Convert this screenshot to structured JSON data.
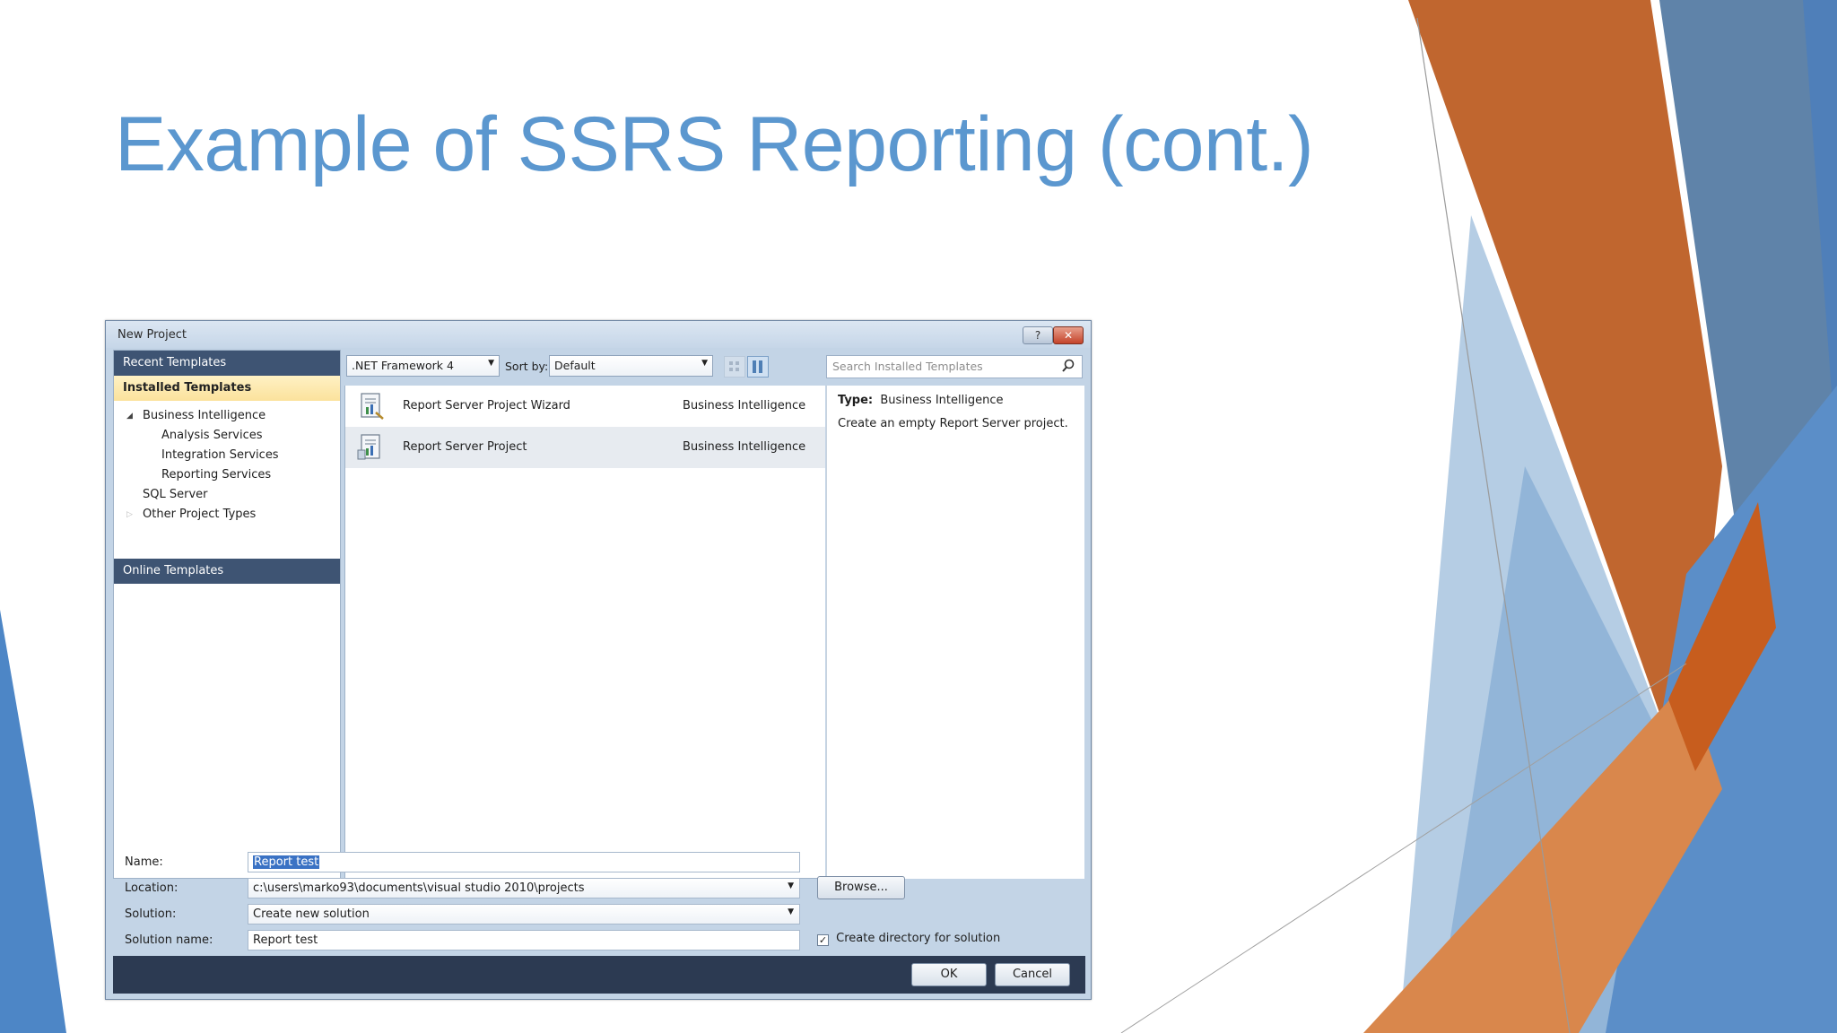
{
  "slide": {
    "title": "Example of SSRS Reporting (cont.)",
    "colors": {
      "title": "#5b97cf",
      "accent_orange": "#c0642e",
      "accent_blue": "#4d86c6"
    }
  },
  "dialog": {
    "title": "New Project",
    "help_glyph": "?",
    "close_glyph": "✕",
    "left_pane": {
      "recent_templates": "Recent Templates",
      "installed_templates": "Installed Templates",
      "tree": [
        {
          "label": "Business Intelligence",
          "expander": "◢"
        },
        {
          "label": "Analysis Services"
        },
        {
          "label": "Integration Services"
        },
        {
          "label": "Reporting Services"
        },
        {
          "label": "SQL Server"
        },
        {
          "label": "Other Project Types",
          "expander": "▷"
        }
      ],
      "online_templates": "Online Templates"
    },
    "toolbar": {
      "framework": ".NET Framework 4",
      "sort_by_label": "Sort by:",
      "sort_by_value": "Default",
      "dropdown_glyph": "▼"
    },
    "search": {
      "placeholder": "Search Installed Templates"
    },
    "templates": [
      {
        "name": "Report Server Project Wizard",
        "category": "Business Intelligence",
        "selected": false
      },
      {
        "name": "Report Server Project",
        "category": "Business Intelligence",
        "selected": true
      }
    ],
    "info": {
      "type_label": "Type:",
      "type_value": "Business Intelligence",
      "description": "Create an empty Report Server project."
    },
    "form": {
      "name_label": "Name:",
      "name_value": "Report test",
      "location_label": "Location:",
      "location_value": "c:\\users\\marko93\\documents\\visual studio 2010\\projects",
      "solution_label": "Solution:",
      "solution_value": "Create new solution",
      "solution_name_label": "Solution name:",
      "solution_name_value": "Report test",
      "browse_label": "Browse...",
      "create_dir_label": "Create directory for solution",
      "create_dir_checked": true,
      "check_glyph": "✓"
    },
    "buttons": {
      "ok": "OK",
      "cancel": "Cancel"
    }
  }
}
